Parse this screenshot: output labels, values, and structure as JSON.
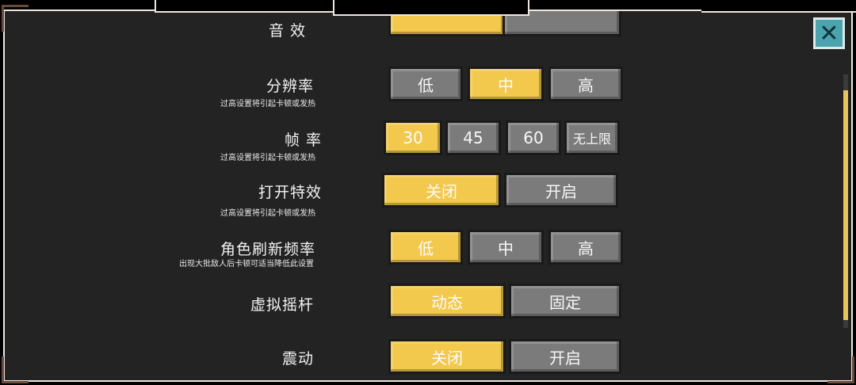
{
  "settings": {
    "sound_label": "音 效",
    "resolution": {
      "label": "分辨率",
      "hint": "过高设置将引起卡顿或发热",
      "options": [
        "低",
        "中",
        "高"
      ],
      "selected": 1
    },
    "framerate": {
      "label": "帧  率",
      "hint": "过高设置将引起卡顿或发热",
      "options": [
        "30",
        "45",
        "60",
        "无上限"
      ],
      "selected": 0
    },
    "effects": {
      "label": "打开特效",
      "hint": "过高设置将引起卡顿或发热",
      "options": [
        "关闭",
        "开启"
      ],
      "selected": 0
    },
    "refresh": {
      "label": "角色刷新频率",
      "hint": "出现大批敌人后卡顿可适当降低此设置",
      "options": [
        "低",
        "中",
        "高"
      ],
      "selected": 0
    },
    "joystick": {
      "label": "虚拟摇杆",
      "options": [
        "动态",
        "固定"
      ],
      "selected": 0
    },
    "vibration": {
      "label": "震动",
      "options": [
        "关闭",
        "开启"
      ],
      "selected": 0
    }
  },
  "close_icon": "close-icon",
  "colors": {
    "selected": "#f2c94c",
    "unselected": "#7b7b7b",
    "panel": "#232323",
    "close": "#4aa3ad"
  }
}
